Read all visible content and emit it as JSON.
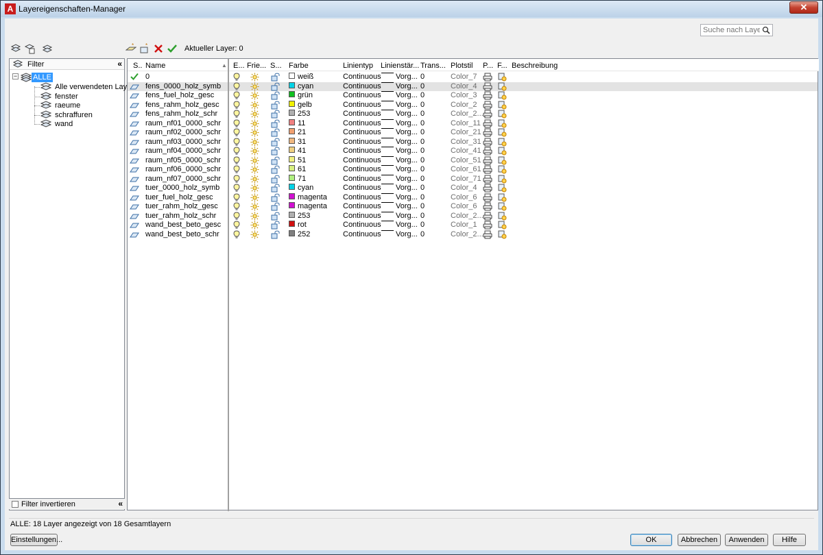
{
  "window": {
    "title": "Layereigenschaften-Manager",
    "close_label": "✕"
  },
  "search": {
    "placeholder": "Suche nach Layer"
  },
  "toolbar": {
    "current_layer_label": "Aktueller Layer: 0"
  },
  "filter_pane": {
    "header": "Filter",
    "root": "ALLE",
    "children": [
      "Alle verwendeten Layer",
      "fenster",
      "raeume",
      "schraffuren",
      "wand"
    ],
    "invert_label": "Filter invertieren"
  },
  "columns": [
    "S..",
    "Name",
    "E...",
    "Frie...",
    "S...",
    "Farbe",
    "Linientyp",
    "Linienstär...",
    "Trans...",
    "Plotstil",
    "P...",
    "F...",
    "Beschreibung"
  ],
  "layers": [
    {
      "name": "0",
      "color_name": "weiß",
      "color_hex": "#ffffff",
      "linetype": "Continuous",
      "lineweight": "Vorg...",
      "trans": "0",
      "plotstyle": "Color_7",
      "current": true
    },
    {
      "name": "fens_0000_holz_symb",
      "color_name": "cyan",
      "color_hex": "#00d2e6",
      "linetype": "Continuous",
      "lineweight": "Vorg...",
      "trans": "0",
      "plotstyle": "Color_4",
      "current": false
    },
    {
      "name": "fens_fuel_holz_gesc",
      "color_name": "grün",
      "color_hex": "#10c020",
      "linetype": "Continuous",
      "lineweight": "Vorg...",
      "trans": "0",
      "plotstyle": "Color_3",
      "current": false
    },
    {
      "name": "fens_rahm_holz_gesc",
      "color_name": "gelb",
      "color_hex": "#f2f200",
      "linetype": "Continuous",
      "lineweight": "Vorg...",
      "trans": "0",
      "plotstyle": "Color_2",
      "current": false
    },
    {
      "name": "fens_rahm_holz_schr",
      "color_name": "253",
      "color_hex": "#b0b0b0",
      "linetype": "Continuous",
      "lineweight": "Vorg...",
      "trans": "0",
      "plotstyle": "Color_2...",
      "current": false
    },
    {
      "name": "raum_nf01_0000_schr",
      "color_name": "11",
      "color_hex": "#f08080",
      "linetype": "Continuous",
      "lineweight": "Vorg...",
      "trans": "0",
      "plotstyle": "Color_11",
      "current": false
    },
    {
      "name": "raum_nf02_0000_schr",
      "color_name": "21",
      "color_hex": "#f0a070",
      "linetype": "Continuous",
      "lineweight": "Vorg...",
      "trans": "0",
      "plotstyle": "Color_21",
      "current": false
    },
    {
      "name": "raum_nf03_0000_schr",
      "color_name": "31",
      "color_hex": "#f0b880",
      "linetype": "Continuous",
      "lineweight": "Vorg...",
      "trans": "0",
      "plotstyle": "Color_31",
      "current": false
    },
    {
      "name": "raum_nf04_0000_schr",
      "color_name": "41",
      "color_hex": "#f0d080",
      "linetype": "Continuous",
      "lineweight": "Vorg...",
      "trans": "0",
      "plotstyle": "Color_41",
      "current": false
    },
    {
      "name": "raum_nf05_0000_schr",
      "color_name": "51",
      "color_hex": "#f0f080",
      "linetype": "Continuous",
      "lineweight": "Vorg...",
      "trans": "0",
      "plotstyle": "Color_51",
      "current": false
    },
    {
      "name": "raum_nf06_0000_schr",
      "color_name": "61",
      "color_hex": "#d8f080",
      "linetype": "Continuous",
      "lineweight": "Vorg...",
      "trans": "0",
      "plotstyle": "Color_61",
      "current": false
    },
    {
      "name": "raum_nf07_0000_schr",
      "color_name": "71",
      "color_hex": "#b0f080",
      "linetype": "Continuous",
      "lineweight": "Vorg...",
      "trans": "0",
      "plotstyle": "Color_71",
      "current": false
    },
    {
      "name": "tuer_0000_holz_symb",
      "color_name": "cyan",
      "color_hex": "#00d2e6",
      "linetype": "Continuous",
      "lineweight": "Vorg...",
      "trans": "0",
      "plotstyle": "Color_4",
      "current": false
    },
    {
      "name": "tuer_fuel_holz_gesc",
      "color_name": "magenta",
      "color_hex": "#d010d0",
      "linetype": "Continuous",
      "lineweight": "Vorg...",
      "trans": "0",
      "plotstyle": "Color_6",
      "current": false
    },
    {
      "name": "tuer_rahm_holz_gesc",
      "color_name": "magenta",
      "color_hex": "#d010d0",
      "linetype": "Continuous",
      "lineweight": "Vorg...",
      "trans": "0",
      "plotstyle": "Color_6",
      "current": false
    },
    {
      "name": "tuer_rahm_holz_schr",
      "color_name": "253",
      "color_hex": "#b0b0b0",
      "linetype": "Continuous",
      "lineweight": "Vorg...",
      "trans": "0",
      "plotstyle": "Color_2...",
      "current": false
    },
    {
      "name": "wand_best_beto_gesc",
      "color_name": "rot",
      "color_hex": "#d01010",
      "linetype": "Continuous",
      "lineweight": "Vorg...",
      "trans": "0",
      "plotstyle": "Color_1",
      "current": false
    },
    {
      "name": "wand_best_beto_schr",
      "color_name": "252",
      "color_hex": "#808080",
      "linetype": "Continuous",
      "lineweight": "Vorg...",
      "trans": "0",
      "plotstyle": "Color_2...",
      "current": false
    }
  ],
  "selected_row": 1,
  "status": "ALLE: 18 Layer angezeigt von 18 Gesamtlayern",
  "buttons": {
    "settings": "Einstellungen...",
    "ok": "OK",
    "cancel": "Abbrechen",
    "apply": "Anwenden",
    "help": "Hilfe"
  },
  "icons": {
    "current_layer": "green-checkmark-icon",
    "layer_status": "layer-sheet-icon",
    "on": "lightbulb-icon",
    "freeze": "sun-icon",
    "lock": "padlock-open-icon",
    "plot": "printer-icon",
    "new_vp_freeze": "viewport-freeze-icon"
  },
  "colors": {
    "selection": "#3399ff",
    "check": "#2ea02e",
    "delete": "#d01010"
  }
}
